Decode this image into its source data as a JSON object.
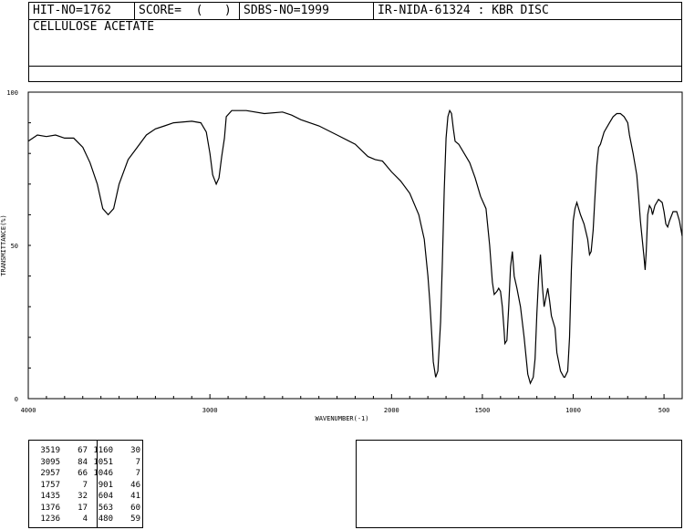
{
  "header": {
    "hit_no": "HIT-NO=1762",
    "score": "SCORE=  (   )",
    "sdbs_no": "SDBS-NO=1999",
    "ir_nida": "IR-NIDA-61324 : KBR DISC",
    "compound": "CELLULOSE ACETATE"
  },
  "chart_data": {
    "type": "line",
    "xlabel": "WAVENUMBER(-1)",
    "ylabel": "TRANSMITTANCE(%)",
    "xlim": [
      4000,
      400
    ],
    "ylim": [
      0,
      100
    ],
    "x_ticks": [
      4000,
      3000,
      2000,
      1500,
      1000,
      500
    ],
    "y_ticks": [
      0,
      50,
      100
    ],
    "grid": false,
    "series": [
      {
        "points": [
          [
            4000,
            84
          ],
          [
            3950,
            86
          ],
          [
            3900,
            85.5
          ],
          [
            3850,
            86
          ],
          [
            3800,
            85
          ],
          [
            3750,
            85
          ],
          [
            3700,
            82
          ],
          [
            3660,
            77
          ],
          [
            3620,
            70
          ],
          [
            3590,
            62
          ],
          [
            3560,
            60
          ],
          [
            3530,
            62
          ],
          [
            3500,
            70
          ],
          [
            3450,
            78
          ],
          [
            3400,
            82
          ],
          [
            3350,
            86
          ],
          [
            3300,
            88
          ],
          [
            3250,
            89
          ],
          [
            3200,
            90
          ],
          [
            3100,
            90.5
          ],
          [
            3050,
            90
          ],
          [
            3020,
            87
          ],
          [
            3000,
            80
          ],
          [
            2985,
            73
          ],
          [
            2965,
            70
          ],
          [
            2950,
            72
          ],
          [
            2935,
            79
          ],
          [
            2920,
            85
          ],
          [
            2910,
            92
          ],
          [
            2880,
            94
          ],
          [
            2800,
            94
          ],
          [
            2700,
            93
          ],
          [
            2600,
            93.5
          ],
          [
            2550,
            92.5
          ],
          [
            2500,
            91
          ],
          [
            2400,
            89
          ],
          [
            2300,
            86
          ],
          [
            2200,
            83
          ],
          [
            2130,
            79
          ],
          [
            2090,
            78
          ],
          [
            2050,
            77.5
          ],
          [
            2000,
            74
          ],
          [
            1950,
            71
          ],
          [
            1900,
            67
          ],
          [
            1850,
            60
          ],
          [
            1820,
            52
          ],
          [
            1800,
            40
          ],
          [
            1790,
            32
          ],
          [
            1780,
            22
          ],
          [
            1770,
            12
          ],
          [
            1757,
            7
          ],
          [
            1745,
            9
          ],
          [
            1730,
            25
          ],
          [
            1720,
            45
          ],
          [
            1710,
            68
          ],
          [
            1700,
            85
          ],
          [
            1690,
            92
          ],
          [
            1680,
            94
          ],
          [
            1670,
            93
          ],
          [
            1660,
            88
          ],
          [
            1650,
            84
          ],
          [
            1630,
            83
          ],
          [
            1600,
            80
          ],
          [
            1570,
            77
          ],
          [
            1540,
            72
          ],
          [
            1510,
            66
          ],
          [
            1480,
            62
          ],
          [
            1460,
            50
          ],
          [
            1445,
            38
          ],
          [
            1435,
            34
          ],
          [
            1420,
            35
          ],
          [
            1410,
            36
          ],
          [
            1400,
            35
          ],
          [
            1390,
            30
          ],
          [
            1380,
            22
          ],
          [
            1376,
            18
          ],
          [
            1365,
            19
          ],
          [
            1355,
            30
          ],
          [
            1345,
            43
          ],
          [
            1335,
            48
          ],
          [
            1325,
            40
          ],
          [
            1310,
            36
          ],
          [
            1290,
            30
          ],
          [
            1270,
            20
          ],
          [
            1250,
            8
          ],
          [
            1236,
            5
          ],
          [
            1220,
            7
          ],
          [
            1210,
            13
          ],
          [
            1200,
            28
          ],
          [
            1190,
            40
          ],
          [
            1180,
            47
          ],
          [
            1170,
            37
          ],
          [
            1160,
            30
          ],
          [
            1150,
            33
          ],
          [
            1140,
            36
          ],
          [
            1130,
            32
          ],
          [
            1120,
            27
          ],
          [
            1110,
            25
          ],
          [
            1100,
            23
          ],
          [
            1090,
            15
          ],
          [
            1070,
            9
          ],
          [
            1051,
            7
          ],
          [
            1046,
            7
          ],
          [
            1030,
            9
          ],
          [
            1020,
            20
          ],
          [
            1010,
            42
          ],
          [
            1000,
            58
          ],
          [
            990,
            62
          ],
          [
            980,
            64
          ],
          [
            960,
            60
          ],
          [
            940,
            57
          ],
          [
            920,
            52
          ],
          [
            910,
            47
          ],
          [
            901,
            48
          ],
          [
            890,
            55
          ],
          [
            880,
            66
          ],
          [
            870,
            76
          ],
          [
            860,
            82
          ],
          [
            850,
            83
          ],
          [
            830,
            87
          ],
          [
            800,
            90
          ],
          [
            780,
            92
          ],
          [
            760,
            93
          ],
          [
            740,
            93
          ],
          [
            720,
            92
          ],
          [
            700,
            90
          ],
          [
            690,
            86
          ],
          [
            670,
            80
          ],
          [
            650,
            73
          ],
          [
            640,
            66
          ],
          [
            630,
            58
          ],
          [
            620,
            52
          ],
          [
            610,
            46
          ],
          [
            604,
            42
          ],
          [
            598,
            48
          ],
          [
            590,
            60
          ],
          [
            580,
            63
          ],
          [
            570,
            62
          ],
          [
            563,
            60
          ],
          [
            550,
            63
          ],
          [
            530,
            65
          ],
          [
            510,
            64
          ],
          [
            500,
            61
          ],
          [
            490,
            57
          ],
          [
            480,
            56
          ],
          [
            470,
            58
          ],
          [
            450,
            61
          ],
          [
            430,
            61
          ],
          [
            415,
            58
          ],
          [
            400,
            53
          ]
        ]
      }
    ]
  },
  "peak_table": [
    [
      "3519",
      "67",
      "1160",
      "30"
    ],
    [
      "3095",
      "84",
      "1051",
      "7"
    ],
    [
      "2957",
      "66",
      "1046",
      "7"
    ],
    [
      "1757",
      "7",
      "901",
      "46"
    ],
    [
      "1435",
      "32",
      "604",
      "41"
    ],
    [
      "1376",
      "17",
      "563",
      "60"
    ],
    [
      "1236",
      "4",
      "480",
      "59"
    ]
  ]
}
